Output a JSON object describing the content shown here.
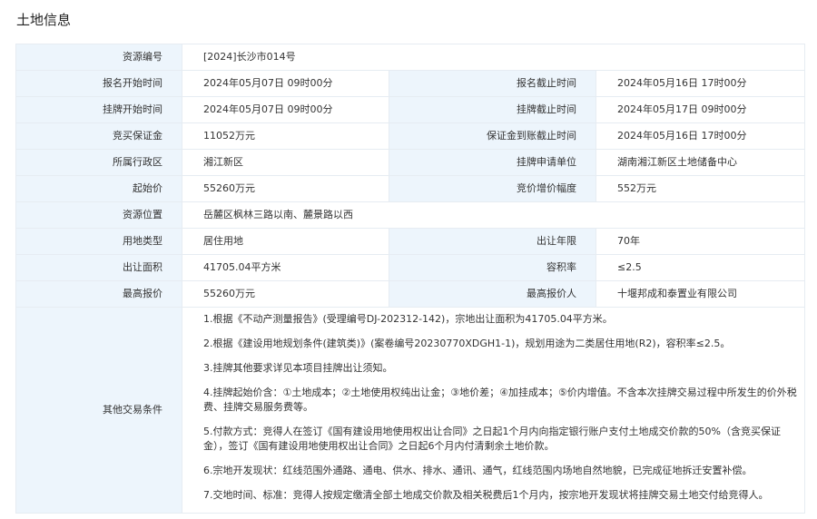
{
  "page": {
    "title": "土地信息"
  },
  "rows": [
    {
      "type": "single",
      "label": "资源编号",
      "value": "[2024]长沙市014号"
    },
    {
      "type": "pair",
      "label1": "报名开始时间",
      "value1": "2024年05月07日 09时00分",
      "label2": "报名截止时间",
      "value2": "2024年05月16日 17时00分"
    },
    {
      "type": "pair",
      "label1": "挂牌开始时间",
      "value1": "2024年05月07日 09时00分",
      "label2": "挂牌截止时间",
      "value2": "2024年05月17日 09时00分"
    },
    {
      "type": "pair",
      "label1": "竞买保证金",
      "value1": "11052万元",
      "label2": "保证金到账截止时间",
      "value2": "2024年05月16日 17时00分"
    },
    {
      "type": "pair",
      "label1": "所属行政区",
      "value1": "湘江新区",
      "label2": "挂牌申请单位",
      "value2": "湖南湘江新区土地储备中心"
    },
    {
      "type": "pair",
      "label1": "起始价",
      "value1": "55260万元",
      "label2": "竞价增价幅度",
      "value2": "552万元"
    },
    {
      "type": "single",
      "label": "资源位置",
      "value": "岳麓区枫林三路以南、麓景路以西"
    },
    {
      "type": "pair",
      "label1": "用地类型",
      "value1": "居住用地",
      "label2": "出让年限",
      "value2": "70年"
    },
    {
      "type": "pair",
      "label1": "出让面积",
      "value1": "41705.04平方米",
      "label2": "容积率",
      "value2": "≤2.5"
    },
    {
      "type": "pair",
      "label1": "最高报价",
      "value1": "55260万元",
      "label2": "最高报价人",
      "value2": "十堰邦成和泰置业有限公司"
    }
  ],
  "conditions": {
    "label": "其他交易条件",
    "items": [
      "1.根据《不动产测量报告》(受理编号DJ-202312-142)，宗地出让面积为41705.04平方米。",
      "2.根据《建设用地规划条件(建筑类)》(案卷编号20230770XDGH1-1)，规划用途为二类居住用地(R2)，容积率≤2.5。",
      "3.挂牌其他要求详见本项目挂牌出让须知。",
      "4.挂牌起始价含：①土地成本；②土地使用权纯出让金；③地价差；④加挂成本；⑤价内增值。不含本次挂牌交易过程中所发生的价外税费、挂牌交易服务费等。",
      "5.付款方式：竞得人在签订《国有建设用地使用权出让合同》之日起1个月内向指定银行账户支付土地成交价款的50%（含竞买保证金），签订《国有建设用地使用权出让合同》之日起6个月内付清剩余土地价款。",
      "6.宗地开发现状：红线范围外通路、通电、供水、排水、通讯、通气，红线范围内场地自然地貌，已完成征地拆迁安置补偿。",
      "7.交地时间、标准：竞得人按规定缴清全部土地成交价款及相关税费后1个月内，按宗地开发现状将挂牌交易土地交付给竞得人。"
    ]
  }
}
